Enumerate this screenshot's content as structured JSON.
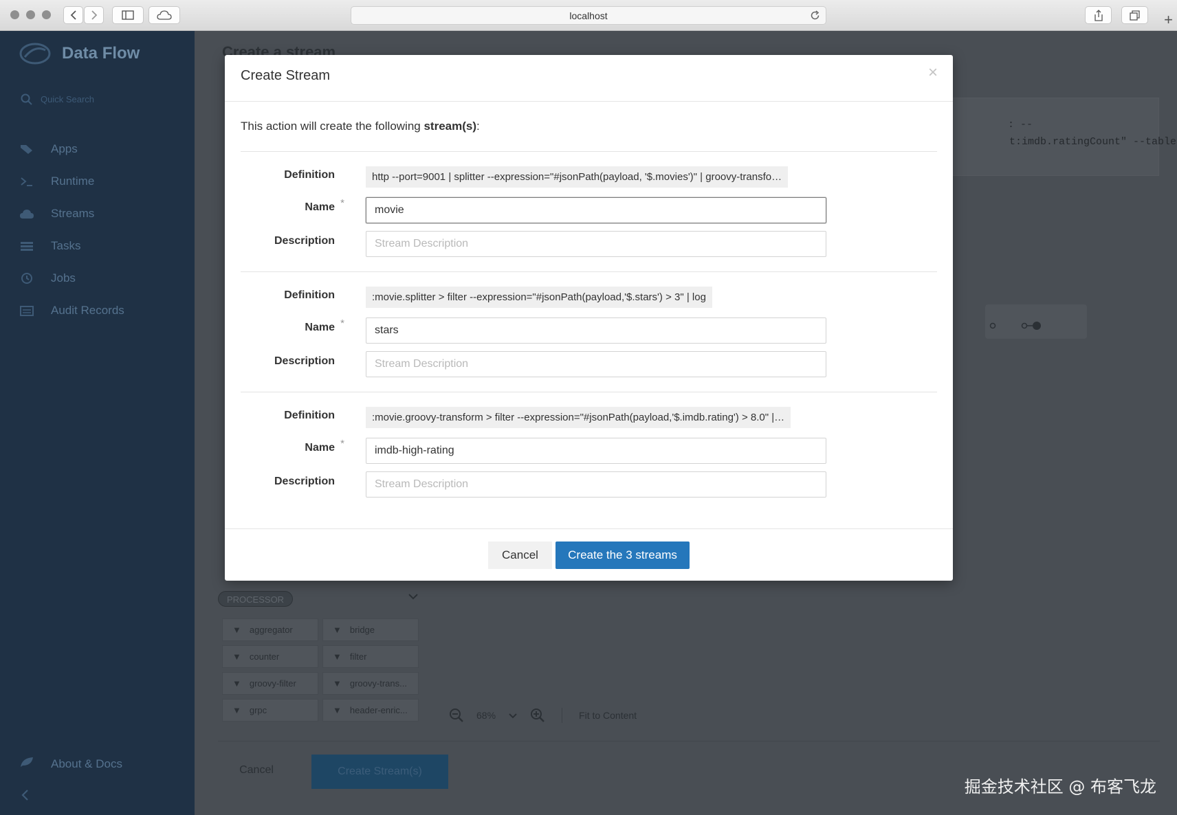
{
  "browser": {
    "url": "localhost"
  },
  "sidebar": {
    "brand": "Data Flow",
    "quick_search_placeholder": "Quick Search",
    "items": [
      {
        "label": "Apps",
        "icon": "tags-icon"
      },
      {
        "label": "Runtime",
        "icon": "terminal-icon"
      },
      {
        "label": "Streams",
        "icon": "cloud-icon"
      },
      {
        "label": "Tasks",
        "icon": "tasks-icon"
      },
      {
        "label": "Jobs",
        "icon": "clock-icon"
      },
      {
        "label": "Audit Records",
        "icon": "records-icon"
      }
    ],
    "about": "About & Docs"
  },
  "background": {
    "page_title": "Create a stream",
    "definition_line1": ": --",
    "definition_line2": "t:imdb.ratingCount\" --table-",
    "palette_group": "PROCESSOR",
    "palette_items": [
      "aggregator",
      "bridge",
      "counter",
      "filter",
      "groovy-filter",
      "groovy-trans...",
      "grpc",
      "header-enric..."
    ],
    "zoom_level": "68%",
    "fit_to_content": "Fit to Content",
    "cancel": "Cancel",
    "create_streams": "Create Stream(s)"
  },
  "modal": {
    "title": "Create Stream",
    "close_symbol": "×",
    "intro_prefix": "This action will create the following ",
    "intro_bold": "stream(s)",
    "intro_suffix": ":",
    "labels": {
      "definition": "Definition",
      "name": "Name",
      "required": "*",
      "description": "Description"
    },
    "description_placeholder": "Stream Description",
    "streams": [
      {
        "definition": "http --port=9001 | splitter --expression=\"#jsonPath(payload, '$.movies')\" | groovy-transfo…",
        "name": "movie"
      },
      {
        "definition": ":movie.splitter > filter --expression=\"#jsonPath(payload,'$.stars') > 3\" | log",
        "name": "stars"
      },
      {
        "definition": ":movie.groovy-transform > filter --expression=\"#jsonPath(payload,'$.imdb.rating') > 8.0\" |…",
        "name": "imdb-high-rating"
      }
    ],
    "cancel_label": "Cancel",
    "create_label": "Create the 3 streams"
  },
  "watermark": "掘金技术社区 @ 布客飞龙",
  "colors": {
    "primary_button": "#2577bb",
    "sidebar_bg": "#1f3145",
    "overlay": "#494e54"
  }
}
